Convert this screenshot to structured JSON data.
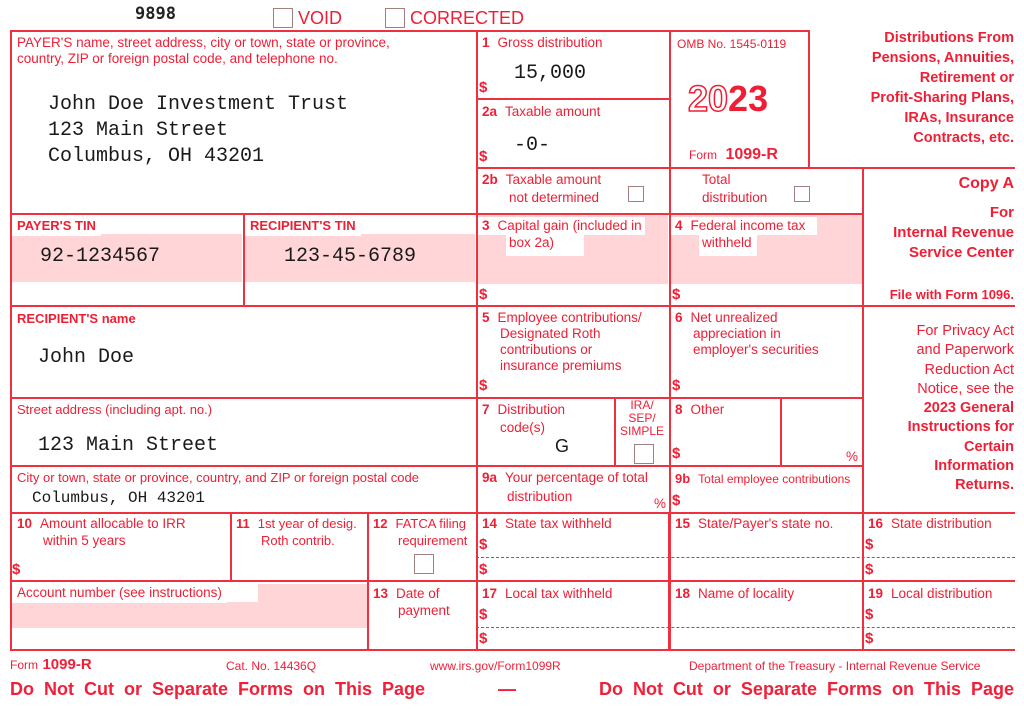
{
  "header": {
    "form_code": "9898",
    "void_label": "VOID",
    "corrected_label": "CORRECTED"
  },
  "payer": {
    "label": "PAYER'S name, street address, city or town, state or province, country, ZIP or foreign postal code, and telephone no.",
    "label_line1": "PAYER'S name, street address, city or town, state or province,",
    "label_line2": "country, ZIP or foreign postal code, and telephone no.",
    "name": "John Doe Investment Trust",
    "street": "123 Main Street",
    "city": "Columbus, OH 43201"
  },
  "payer_tin": {
    "label": "PAYER'S TIN",
    "value": "92-1234567"
  },
  "recipient_tin": {
    "label": "RECIPIENT'S TIN",
    "value": "123-45-6789"
  },
  "recipient_name": {
    "label": "RECIPIENT'S name",
    "value": "John Doe"
  },
  "street_address": {
    "label": "Street address (including apt. no.)",
    "value": "123 Main Street"
  },
  "city_state": {
    "label": "City or town, state or province, country, and ZIP or foreign postal code",
    "value": "Columbus, OH 43201"
  },
  "boxes": {
    "b1": {
      "num": "1",
      "label": "Gross distribution",
      "value": "15,000"
    },
    "b2a": {
      "num": "2a",
      "label": "Taxable amount",
      "value": "-0-"
    },
    "b2b": {
      "num": "2b",
      "label1": "Taxable amount",
      "label2": "not determined"
    },
    "total_dist": {
      "label1": "Total",
      "label2": "distribution"
    },
    "b3": {
      "num": "3",
      "label1": "Capital gain (included in",
      "label2": "box 2a)"
    },
    "b4": {
      "num": "4",
      "label1": "Federal income tax",
      "label2": "withheld"
    },
    "b5": {
      "num": "5",
      "label1": "Employee contributions/",
      "label2": "Designated Roth",
      "label3": "contributions or",
      "label4": "insurance premiums"
    },
    "b6": {
      "num": "6",
      "label1": "Net unrealized",
      "label2": "appreciation in",
      "label3": "employer's securities"
    },
    "b7": {
      "num": "7",
      "label1": "Distribution",
      "label2": "code(s)",
      "value": "G"
    },
    "ira": {
      "label1": "IRA/",
      "label2": "SEP/",
      "label3": "SIMPLE"
    },
    "b8": {
      "num": "8",
      "label": "Other",
      "pct": "%"
    },
    "b9a": {
      "num": "9a",
      "label1": "Your percentage of total",
      "label2": "distribution",
      "pct": "%"
    },
    "b9b": {
      "num": "9b",
      "label": "Total employee contributions"
    },
    "b10": {
      "num": "10",
      "label1": "Amount allocable to IRR",
      "label2": "within 5 years"
    },
    "b11": {
      "num": "11",
      "label1": "1st year of desig.",
      "label2": "Roth contrib."
    },
    "b12": {
      "num": "12",
      "label1": "FATCA filing",
      "label2": "requirement"
    },
    "b13": {
      "num": "13",
      "label1": "Date of",
      "label2": "payment"
    },
    "b14": {
      "num": "14",
      "label": "State tax withheld"
    },
    "b15": {
      "num": "15",
      "label": "State/Payer's state no."
    },
    "b16": {
      "num": "16",
      "label": "State distribution"
    },
    "b17": {
      "num": "17",
      "label": "Local tax withheld"
    },
    "b18": {
      "num": "18",
      "label": "Name of locality"
    },
    "b19": {
      "num": "19",
      "label": "Local distribution"
    },
    "account": {
      "label": "Account number (see instructions)"
    }
  },
  "omb": {
    "number": "OMB No. 1545-0119",
    "year_outline": "20",
    "year_bold": "23",
    "form_word": "Form",
    "form_name": "1099-R"
  },
  "side": {
    "title_lines": [
      "Distributions From",
      "Pensions, Annuities,",
      "Retirement or",
      "Profit-Sharing Plans,",
      "IRAs, Insurance",
      "Contracts, etc."
    ],
    "copy": "Copy A",
    "for_lines": [
      "For",
      "Internal Revenue",
      "Service Center"
    ],
    "file_with": "File with Form 1096.",
    "privacy_lines": [
      "For Privacy Act",
      "and Paperwork",
      "Reduction Act",
      "Notice, see the"
    ],
    "privacy_bold_lines": [
      "2023 General",
      "Instructions for",
      "Certain",
      "Information",
      "Returns."
    ]
  },
  "footer": {
    "form_word": "Form",
    "form_name": "1099-R",
    "cat_no": "Cat. No. 14436Q",
    "url": "www.irs.gov/Form1099R",
    "dept": "Department of the Treasury - Internal Revenue Service",
    "warning_left": "Do Not Cut or Separate Forms on This Page",
    "dash": "—",
    "warning_right": "Do Not Cut or Separate Forms on This Page"
  },
  "currency_symbol": "$"
}
